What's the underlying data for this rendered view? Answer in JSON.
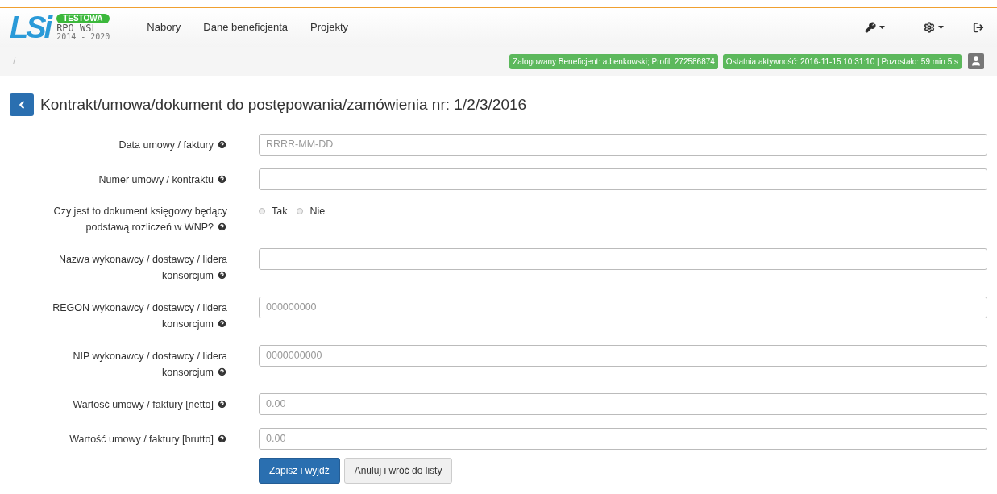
{
  "logo": {
    "letters": "LSi",
    "badge": "TESTOWA",
    "line1": "RPO WSL",
    "line2": "2014 - 2020"
  },
  "nav": [
    {
      "label": "Nabory"
    },
    {
      "label": "Dane beneficjenta"
    },
    {
      "label": "Projekty"
    }
  ],
  "breadcrumb": "/",
  "status_badges": [
    "Zalogowany Beneficjent: a.benkowski; Profil: 272586874",
    "Ostatnia aktywność: 2016-11-15 10:31:10 | Pozostało: 59 min 5 s"
  ],
  "title": "Kontrakt/umowa/dokument do postępowania/zamówienia nr: 1/2/3/2016",
  "fields": [
    {
      "kind": "input",
      "label": "Data umowy / faktury",
      "placeholder": "RRRR-MM-DD"
    },
    {
      "kind": "input",
      "label": "Numer umowy / kontraktu"
    },
    {
      "kind": "radio",
      "label": "Czy jest to dokument księgowy będący podstawą rozliczeń w WNP?",
      "options": [
        {
          "label": "Tak",
          "selected": false
        },
        {
          "label": "Nie",
          "selected": false
        }
      ]
    },
    {
      "kind": "input",
      "label": "Nazwa wykonawcy / dostawcy / lidera konsorcjum"
    },
    {
      "kind": "input",
      "label": "REGON wykonawcy / dostawcy / lidera konsorcjum",
      "placeholder": "000000000"
    },
    {
      "kind": "input",
      "label": "NIP wykonawcy / dostawcy / lidera konsorcjum",
      "placeholder": "0000000000"
    },
    {
      "kind": "input",
      "label": "Wartość umowy / faktury [netto]",
      "placeholder": "0.00"
    },
    {
      "kind": "input",
      "label": "Wartość umowy / faktury [brutto]",
      "placeholder": "0.00"
    }
  ],
  "buttons": [
    {
      "label": "Zapisz i wyjdź",
      "kind": "primary"
    },
    {
      "label": "Anuluj i wróć do listy",
      "kind": "default"
    }
  ]
}
